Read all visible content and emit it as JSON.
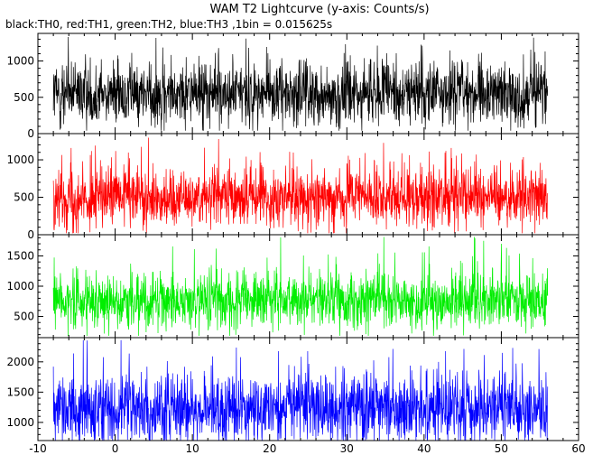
{
  "chart_data": {
    "type": "line",
    "title": "WAM T2 Lightcurve (y-axis: Counts/s)",
    "subtitle": "black:TH0, red:TH1, green:TH2, blue:TH3 ,1bin = 0.015625s",
    "xlim": [
      -10,
      60
    ],
    "xticks": [
      -10,
      0,
      10,
      20,
      30,
      40,
      50,
      60
    ],
    "data_x_range": [
      -8,
      56
    ],
    "panels": [
      {
        "channel": "TH0",
        "color": "#000000",
        "ylim": [
          0,
          1380
        ],
        "yticks": [
          0,
          500,
          1000
        ],
        "mean": 550,
        "noise_std": 215,
        "min": 40,
        "max": 1340
      },
      {
        "channel": "TH1",
        "color": "#ff0000",
        "ylim": [
          0,
          1350
        ],
        "yticks": [
          0,
          500,
          1000
        ],
        "mean": 505,
        "noise_std": 200,
        "min": 20,
        "max": 1320
      },
      {
        "channel": "TH2",
        "color": "#00ee00",
        "ylim": [
          150,
          1850
        ],
        "yticks": [
          500,
          1000,
          1500
        ],
        "mean": 760,
        "noise_std": 240,
        "min": 180,
        "max": 1830
      },
      {
        "channel": "TH3",
        "color": "#0000ff",
        "ylim": [
          700,
          2400
        ],
        "yticks": [
          1000,
          1500,
          2000
        ],
        "mean": 1230,
        "noise_std": 290,
        "min": 700,
        "max": 2380
      }
    ]
  }
}
